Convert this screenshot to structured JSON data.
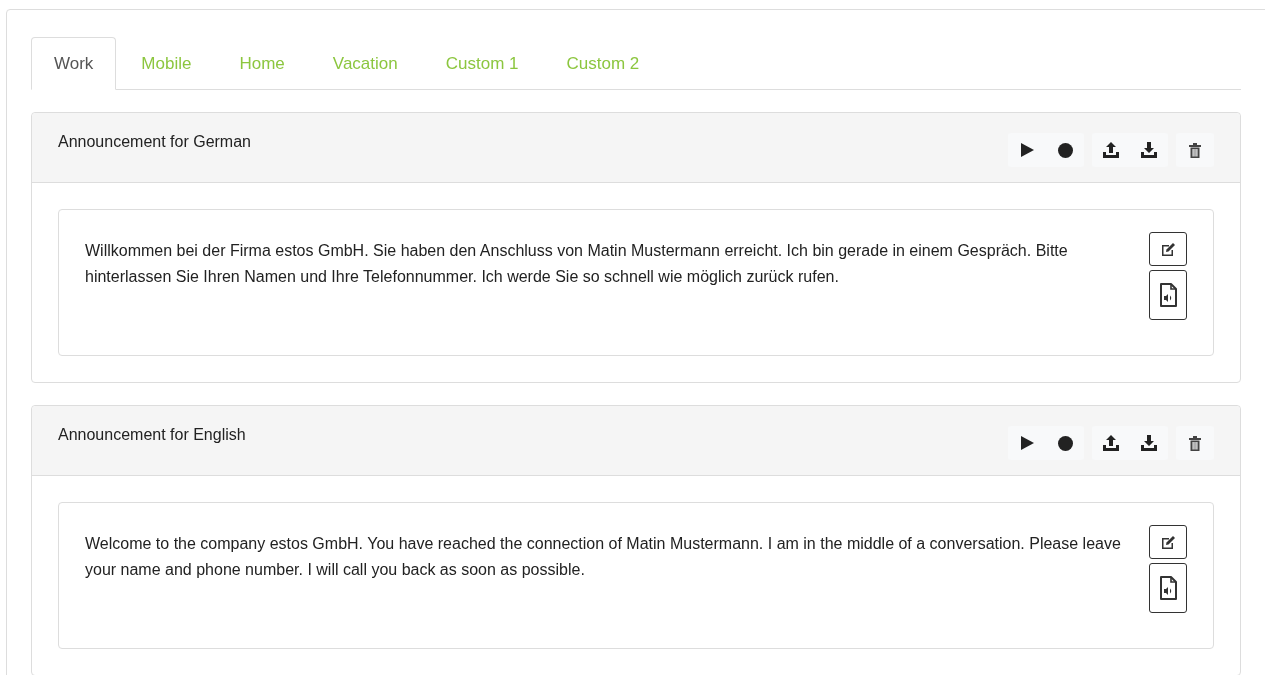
{
  "tabs": [
    {
      "label": "Work",
      "selected": true
    },
    {
      "label": "Mobile",
      "selected": false
    },
    {
      "label": "Home",
      "selected": false
    },
    {
      "label": "Vacation",
      "selected": false
    },
    {
      "label": "Custom 1",
      "selected": false
    },
    {
      "label": "Custom 2",
      "selected": false
    }
  ],
  "announcements": [
    {
      "title": "Announcement for German",
      "text": "Willkommen bei der Firma estos GmbH. Sie haben den Anschluss von Matin Mustermann erreicht. Ich bin gerade in einem Gespräch. Bitte hinterlassen Sie Ihren Namen und Ihre Telefonnummer. Ich werde Sie so schnell wie möglich zurück rufen."
    },
    {
      "title": "Announcement for English",
      "text": "Welcome to the company estos GmbH. You have reached the connection of Matin Mustermann. I am in the middle of a conversation. Please leave your name and phone number. I will call you back as soon as possible."
    }
  ]
}
